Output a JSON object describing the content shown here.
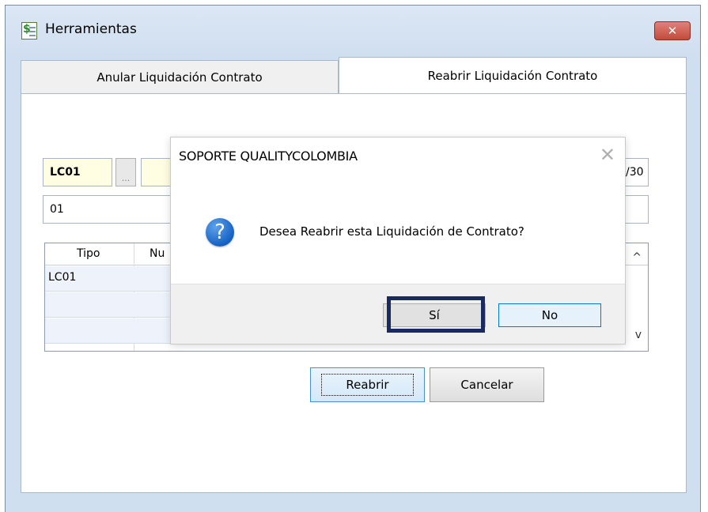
{
  "window": {
    "title": "Herramientas",
    "close_label": "✕"
  },
  "tabs": [
    {
      "label": "Anular Liquidación Contrato",
      "active": false
    },
    {
      "label": "Reabrir Liquidación Contrato",
      "active": true
    }
  ],
  "form": {
    "code_value": "LC01",
    "lookup_label": "...",
    "description_value": "",
    "date_partial": "/30",
    "field2_value": "01"
  },
  "grid": {
    "columns": [
      "Tipo",
      "Nu"
    ],
    "rows": [
      {
        "tipo": "LC01"
      }
    ],
    "scroll_up": "^",
    "scroll_down": "v"
  },
  "buttons": {
    "reabrir": "Reabrir",
    "cancelar": "Cancelar"
  },
  "dialog": {
    "title": "SOPORTE QUALITYCOLOMBIA",
    "close_label": "✕",
    "icon_glyph": "?",
    "message": "Desea Reabrir esta Liquidación de Contrato?",
    "yes_label": "Sí",
    "no_label": "No"
  },
  "colors": {
    "highlight_border": "#1a2a5c",
    "focus_blue": "#0078d7",
    "field_yellow": "#fffde2"
  }
}
